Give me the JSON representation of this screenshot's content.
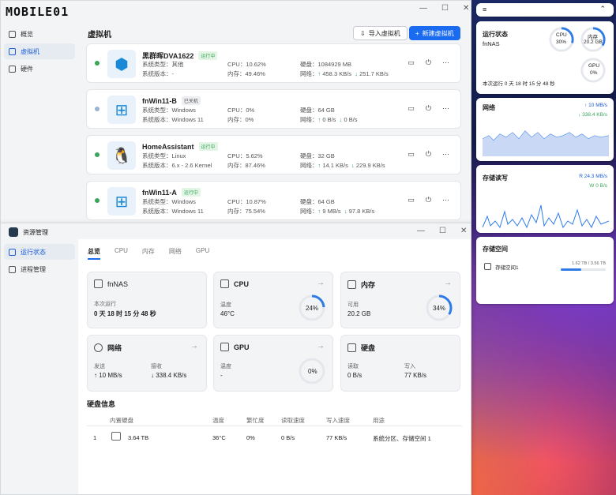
{
  "watermark": "MOBILE01",
  "vm_window": {
    "nav": [
      {
        "label": "概览",
        "icon": "overview-icon"
      },
      {
        "label": "虚拟机",
        "icon": "cube-icon"
      },
      {
        "label": "硬件",
        "icon": "hardware-icon"
      }
    ],
    "title": "虚拟机",
    "import_label": "导入虚拟机",
    "new_label": "新建虚拟机",
    "vms": [
      {
        "name": "黑群晖DVA1622",
        "status": "运行中",
        "os_type": "系统类型：其他",
        "os_ver": "系统版本：-",
        "cpu": "CPU：10.62%",
        "mem": "内存：49.46%",
        "disk": "硬盘：1084929 MB",
        "net_up": "458.3 KB/s",
        "net_down": "251.7 KB/s",
        "net_label": "网络：",
        "status_color": "#3aa55a",
        "logo": "cube-logo"
      },
      {
        "name": "fnWin11-B",
        "status": "已关机",
        "os_type": "系统类型：Windows",
        "os_ver": "系统版本：Windows 11",
        "cpu": "CPU：0%",
        "mem": "内存：0%",
        "disk": "硬盘：64 GB",
        "net_up": "0 B/s",
        "net_down": "0 B/s",
        "net_label": "网络：",
        "status_color": "#9ab2d6",
        "logo": "windows-logo"
      },
      {
        "name": "HomeAssistant",
        "status": "运行中",
        "os_type": "系统类型：Linux",
        "os_ver": "系统版本：6.x - 2.6 Kernel",
        "cpu": "CPU：5.62%",
        "mem": "内存：87.46%",
        "disk": "硬盘：32 GB",
        "net_up": "14.1 KB/s",
        "net_down": "229.9 KB/s",
        "net_label": "网络：",
        "status_color": "#3aa55a",
        "logo": "linux-logo"
      },
      {
        "name": "fnWin11-A",
        "status": "运行中",
        "os_type": "系统类型：Windows",
        "os_ver": "系统版本：Windows 11",
        "cpu": "CPU：10.87%",
        "mem": "内存：75.54%",
        "disk": "硬盘：64 GB",
        "net_up": "9 MB/s",
        "net_down": "97.8 KB/s",
        "net_label": "网络：",
        "status_color": "#3aa55a",
        "logo": "windows-logo"
      }
    ]
  },
  "res_window": {
    "title": "资源管理",
    "nav": [
      {
        "label": "运行状态"
      },
      {
        "label": "进程管理"
      }
    ],
    "tabs": [
      "总览",
      "CPU",
      "内存",
      "网络",
      "GPU"
    ],
    "sys": {
      "name": "fnNAS",
      "label": "本次运行",
      "uptime": "0 天 18 时 15 分 48 秒"
    },
    "cpu": {
      "title": "CPU",
      "temp_label": "温度",
      "temp": "46°C",
      "pct": "24%",
      "pct_value": 0.24
    },
    "mem": {
      "title": "内存",
      "avail_label": "可用",
      "avail": "20.2 GB",
      "pct": "34%",
      "pct_value": 0.34
    },
    "net": {
      "title": "网络",
      "send_label": "发送",
      "send": "10 MB/s",
      "recv_label": "接收",
      "recv": "338.4 KB/s"
    },
    "gpu": {
      "title": "GPU",
      "temp_label": "温度",
      "temp": "-",
      "pct": "0%",
      "pct_value": 0
    },
    "disk": {
      "title": "硬盘",
      "read_label": "读取",
      "read": "0 B/s",
      "write_label": "写入",
      "write": "77 KB/s"
    },
    "disk_info": {
      "title": "硬盘信息",
      "headers": [
        "内置硬盘",
        "温度",
        "繁忙度",
        "读取速度",
        "写入速度",
        "用途"
      ],
      "row": {
        "index": "1",
        "size": "3.64 TB",
        "temp": "36°C",
        "busy": "0%",
        "read": "0 B/s",
        "write": "77 KB/s",
        "usage": "系统分区、存储空间 1"
      }
    }
  },
  "widgets": {
    "status": {
      "title": "运行状态",
      "host": "fnNAS",
      "uptime": "本次运行 0 天 18 时 15 分 48 秒",
      "cpu_label": "CPU",
      "cpu": "30%",
      "cpu_value": 0.3,
      "mem_label": "内存",
      "mem": "20.2 GB",
      "mem_value": 0.34,
      "gpu_label": "GPU",
      "gpu": "0%",
      "gpu_value": 0
    },
    "net": {
      "title": "网络",
      "up": "10 MB/s",
      "down": "338.4 KB/s"
    },
    "io": {
      "title": "存储读写",
      "read_label": "R",
      "read": "24.3 MB/s",
      "write_label": "W",
      "write": "0 B/s"
    },
    "space": {
      "title": "存储空间",
      "pool": "存储空间1",
      "usage": "1.62 TB / 3.56 TB",
      "usage_value": 0.455
    }
  },
  "colors": {
    "accent": "#1a6bf0",
    "running": "#3aa55a"
  }
}
